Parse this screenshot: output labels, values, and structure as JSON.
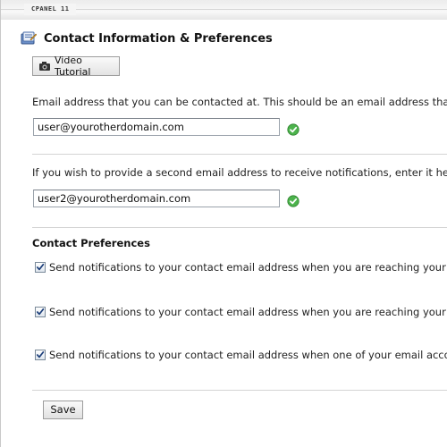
{
  "brand": {
    "label": "CPANEL 11"
  },
  "header": {
    "title": "Contact Information & Preferences"
  },
  "toolbar": {
    "video_tutorial_label": "Video Tutorial"
  },
  "primary_email": {
    "description": "Email address that you can be contacted at. This should be an email address that",
    "value": "user@yourotherdomain.com",
    "status_icon": "check-circle-icon"
  },
  "secondary_email": {
    "description": "If you wish to provide a second email address to receive notifications, enter it he",
    "value": "user2@yourotherdomain.com",
    "status_icon": "check-circle-icon"
  },
  "contact_preferences": {
    "heading": "Contact Preferences",
    "items": [
      {
        "label": "Send notifications to your contact email address when you are reaching your d",
        "checked": true
      },
      {
        "label": "Send notifications to your contact email address when you are reaching your",
        "checked": true
      },
      {
        "label": "Send notifications to your contact email address when one of your email acco",
        "checked": true
      }
    ]
  },
  "actions": {
    "save_label": "Save"
  },
  "colors": {
    "check_green": "#3aa33a",
    "divider": "#d4d4d4",
    "input_border": "#9aa2ab"
  }
}
